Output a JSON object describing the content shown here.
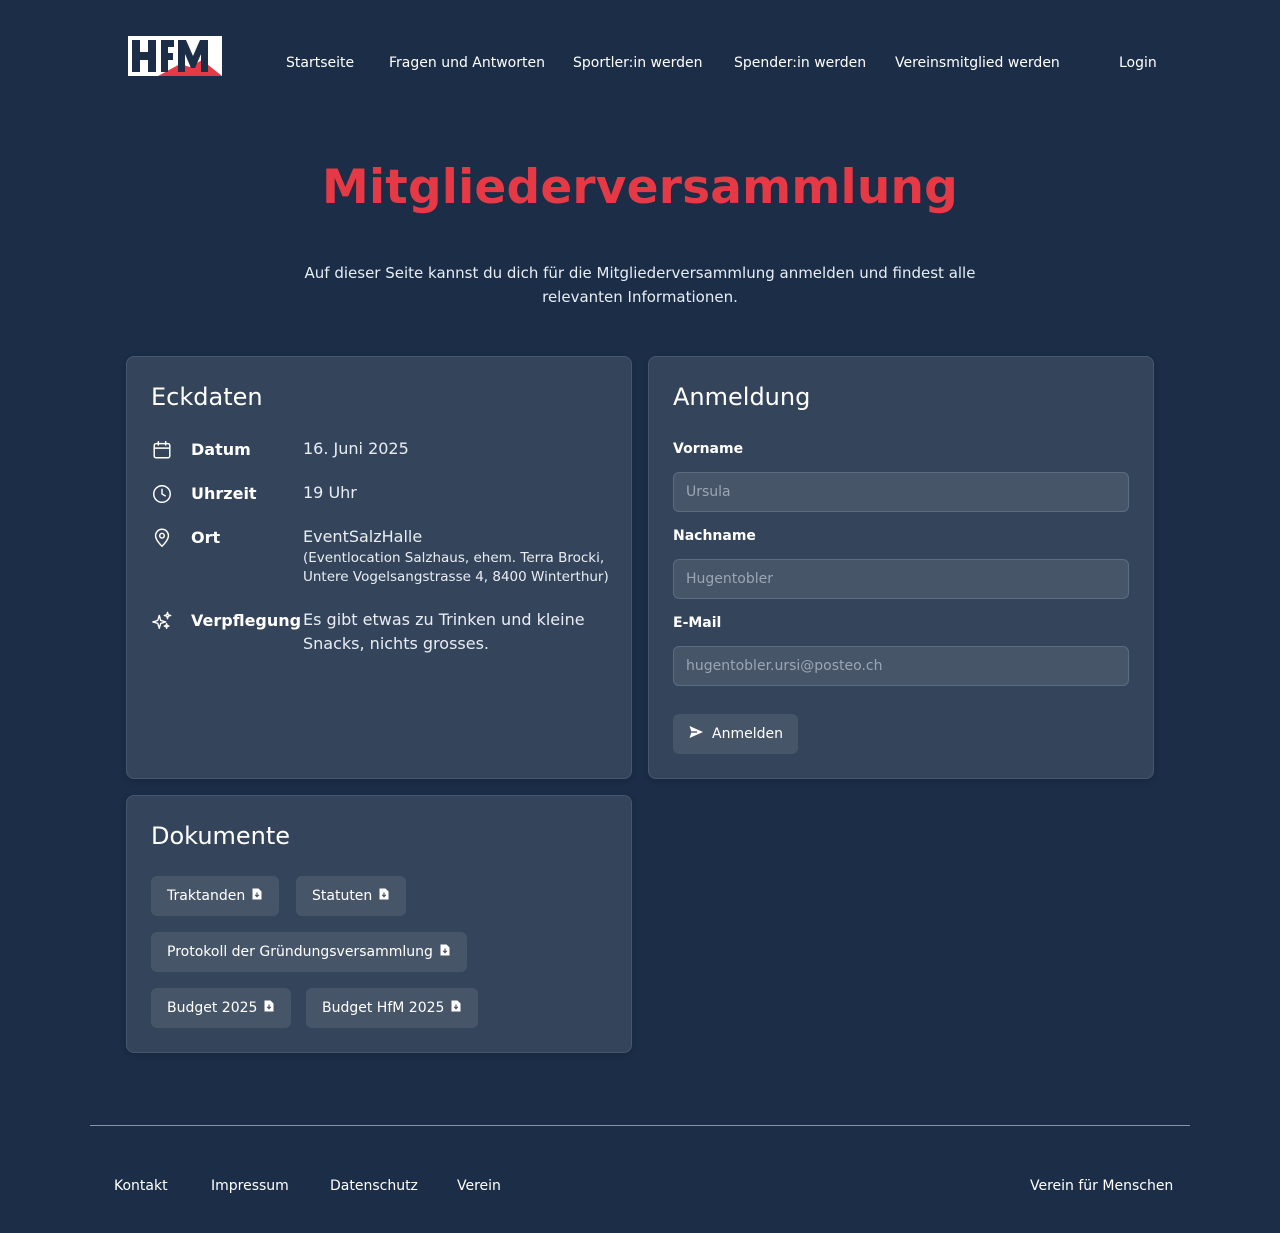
{
  "header": {
    "logo_text": "HfM",
    "nav": [
      "Startseite",
      "Fragen und Antworten",
      "Sportler:in werden",
      "Spender:in werden",
      "Vereinsmitglied werden"
    ],
    "login": "Login"
  },
  "hero": {
    "title": "Mitgliederversammlung",
    "intro": "Auf dieser Seite kannst du dich für die Mitgliederversammlung anmelden und findest alle relevanten Informationen."
  },
  "eckdaten": {
    "title": "Eckdaten",
    "datum": {
      "label": "Datum",
      "value": "16. Juni 2025",
      "icon": "calendar-icon"
    },
    "uhrzeit": {
      "label": "Uhrzeit",
      "value": "19 Uhr",
      "icon": "clock-icon"
    },
    "ort": {
      "label": "Ort",
      "value": "EventSalzHalle",
      "detail_1": "(Eventlocation Salzhaus, ehem. Terra Brocki,",
      "detail_2": "Untere Vogelsangstrasse 4, 8400 Winterthur)",
      "icon": "location-pin-icon"
    },
    "verpflegung": {
      "label": "Verpflegung",
      "value_1": "Es gibt etwas zu Trinken und kleine",
      "value_2": "Snacks, nichts grosses.",
      "icon": "sparkles-icon"
    }
  },
  "anmeldung": {
    "title": "Anmeldung",
    "vorname": {
      "label": "Vorname",
      "placeholder": "Ursula"
    },
    "nachname": {
      "label": "Nachname",
      "placeholder": "Hugentobler"
    },
    "email": {
      "label": "E-Mail",
      "placeholder": "hugentobler.ursi@posteo.ch"
    },
    "submit": "Anmelden"
  },
  "dokumente": {
    "title": "Dokumente",
    "items": [
      "Traktanden",
      "Statuten",
      "Protokoll der Gründungsversammlung",
      "Budget 2025",
      "Budget HfM 2025"
    ]
  },
  "footer": {
    "links": [
      "Kontakt",
      "Impressum",
      "Datenschutz",
      "Verein"
    ],
    "tagline": "Verein für Menschen"
  },
  "colors": {
    "background": "#1b2d47",
    "card": "#34445b",
    "accent": "#e63946",
    "input": "#475569"
  }
}
